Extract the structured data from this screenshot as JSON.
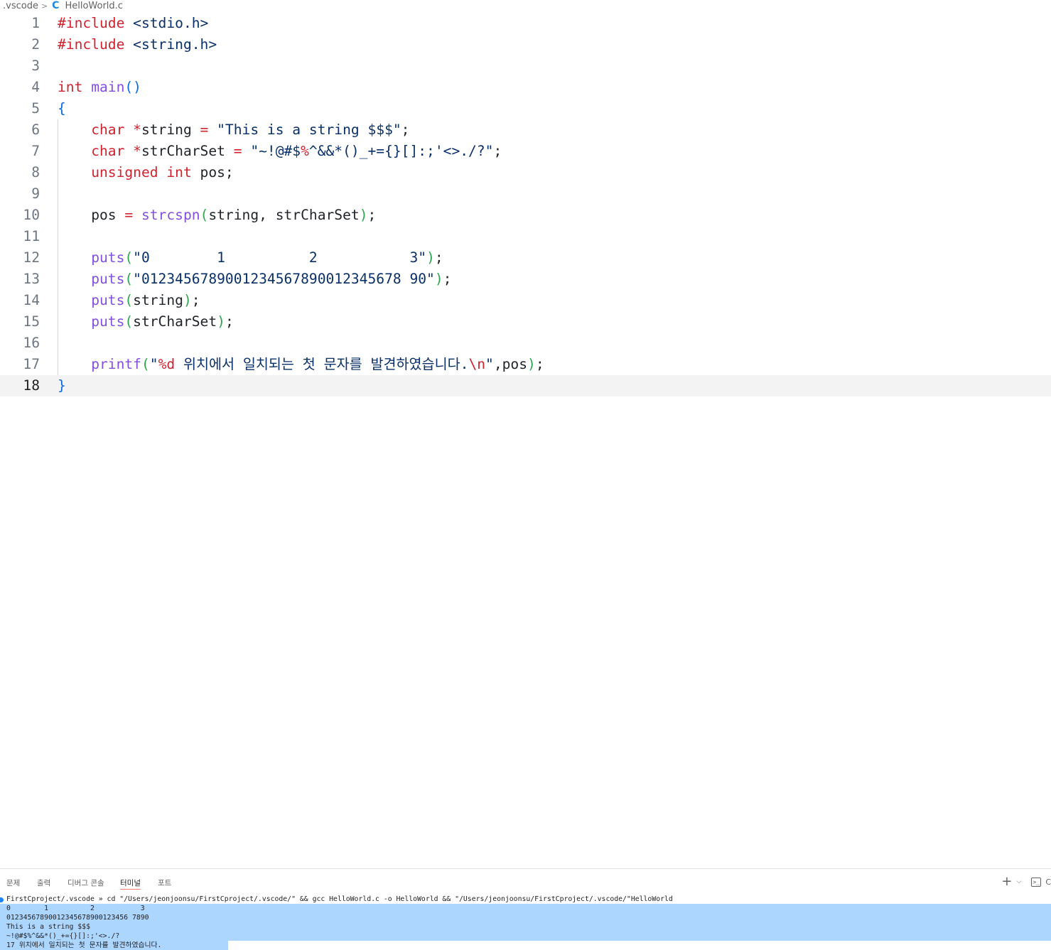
{
  "breadcrumb": {
    "folder": ".vscode",
    "separator": ">",
    "file_icon_glyph": "C",
    "file": "HelloWorld.c"
  },
  "editor": {
    "current_line": 18,
    "lines": [
      {
        "n": "1",
        "tokens": [
          [
            "kw",
            "#include"
          ],
          [
            "plain",
            " "
          ],
          [
            "inc",
            "<stdio.h>"
          ]
        ]
      },
      {
        "n": "2",
        "tokens": [
          [
            "kw",
            "#include"
          ],
          [
            "plain",
            " "
          ],
          [
            "inc",
            "<string.h>"
          ]
        ]
      },
      {
        "n": "3",
        "tokens": []
      },
      {
        "n": "4",
        "tokens": [
          [
            "kw",
            "int"
          ],
          [
            "plain",
            " "
          ],
          [
            "fn",
            "main"
          ],
          [
            "b1",
            "()"
          ]
        ]
      },
      {
        "n": "5",
        "tokens": [
          [
            "b1",
            "{"
          ]
        ]
      },
      {
        "n": "6",
        "tokens": [
          [
            "plain",
            "    "
          ],
          [
            "kw",
            "char"
          ],
          [
            "plain",
            " "
          ],
          [
            "op",
            "*"
          ],
          [
            "var",
            "string"
          ],
          [
            "plain",
            " "
          ],
          [
            "op",
            "="
          ],
          [
            "plain",
            " "
          ],
          [
            "str",
            "\"This is a string $$$\""
          ],
          [
            "var",
            ";"
          ]
        ]
      },
      {
        "n": "7",
        "tokens": [
          [
            "plain",
            "    "
          ],
          [
            "kw",
            "char"
          ],
          [
            "plain",
            " "
          ],
          [
            "op",
            "*"
          ],
          [
            "var",
            "strCharSet"
          ],
          [
            "plain",
            " "
          ],
          [
            "op",
            "="
          ],
          [
            "plain",
            " "
          ],
          [
            "str",
            "\"~!@#$"
          ],
          [
            "esc",
            "%"
          ],
          [
            "str",
            "^&&*()_+={}[]:;'<>./?\""
          ],
          [
            "var",
            ";"
          ]
        ]
      },
      {
        "n": "8",
        "tokens": [
          [
            "plain",
            "    "
          ],
          [
            "kw",
            "unsigned"
          ],
          [
            "plain",
            " "
          ],
          [
            "kw",
            "int"
          ],
          [
            "plain",
            " "
          ],
          [
            "var",
            "pos;"
          ]
        ]
      },
      {
        "n": "9",
        "tokens": []
      },
      {
        "n": "10",
        "tokens": [
          [
            "plain",
            "    "
          ],
          [
            "var",
            "pos"
          ],
          [
            "plain",
            " "
          ],
          [
            "op",
            "="
          ],
          [
            "plain",
            " "
          ],
          [
            "fn",
            "strcspn"
          ],
          [
            "b2",
            "("
          ],
          [
            "var",
            "string, strCharSet"
          ],
          [
            "b2",
            ")"
          ],
          [
            "var",
            ";"
          ]
        ]
      },
      {
        "n": "11",
        "tokens": []
      },
      {
        "n": "12",
        "tokens": [
          [
            "plain",
            "    "
          ],
          [
            "fn",
            "puts"
          ],
          [
            "b2",
            "("
          ],
          [
            "str",
            "\"0        1          2           3\""
          ],
          [
            "b2",
            ")"
          ],
          [
            "var",
            ";"
          ]
        ]
      },
      {
        "n": "13",
        "tokens": [
          [
            "plain",
            "    "
          ],
          [
            "fn",
            "puts"
          ],
          [
            "b2",
            "("
          ],
          [
            "str",
            "\"0123456789001234567890012345678 90\""
          ],
          [
            "b2",
            ")"
          ],
          [
            "var",
            ";"
          ]
        ]
      },
      {
        "n": "14",
        "tokens": [
          [
            "plain",
            "    "
          ],
          [
            "fn",
            "puts"
          ],
          [
            "b2",
            "("
          ],
          [
            "var",
            "string"
          ],
          [
            "b2",
            ")"
          ],
          [
            "var",
            ";"
          ]
        ]
      },
      {
        "n": "15",
        "tokens": [
          [
            "plain",
            "    "
          ],
          [
            "fn",
            "puts"
          ],
          [
            "b2",
            "("
          ],
          [
            "var",
            "strCharSet"
          ],
          [
            "b2",
            ")"
          ],
          [
            "var",
            ";"
          ]
        ]
      },
      {
        "n": "16",
        "tokens": []
      },
      {
        "n": "17",
        "tokens": [
          [
            "plain",
            "    "
          ],
          [
            "fn",
            "printf"
          ],
          [
            "b2",
            "("
          ],
          [
            "str",
            "\""
          ],
          [
            "esc",
            "%d"
          ],
          [
            "str",
            " 위치에서 일치되는 첫 문자를 발견하였습니다."
          ],
          [
            "esc",
            "\\n"
          ],
          [
            "str",
            "\""
          ],
          [
            "var",
            ",pos"
          ],
          [
            "b2",
            ")"
          ],
          [
            "var",
            ";"
          ]
        ]
      },
      {
        "n": "18",
        "tokens": [
          [
            "b1",
            "}"
          ]
        ]
      }
    ]
  },
  "panel": {
    "tabs": [
      {
        "label": "문제",
        "active": false
      },
      {
        "label": "출력",
        "active": false
      },
      {
        "label": "디버그 콘솔",
        "active": false
      },
      {
        "label": "터미널",
        "active": true
      },
      {
        "label": "포트",
        "active": false
      }
    ],
    "actions": {
      "plus": "+",
      "chevron": "⌵",
      "terminal_icon": ">_",
      "cut_label": "C"
    }
  },
  "terminal": {
    "lines": [
      "FirstCproject/.vscode » cd \"/Users/jeonjoonsu/FirstCproject/.vscode/\" && gcc HelloWorld.c -o HelloWorld && \"/Users/jeonjoonsu/FirstCproject/.vscode/\"HelloWorld",
      "0        1          2           3",
      "01234567890012345678900123456 7890",
      "This is a string $$$",
      "~!@#$%^&&*()_+={}[]:;'<>./?",
      "17 위치에서 일치되는 첫 문자를 발견하였습니다."
    ]
  },
  "colors": {
    "keyword": "#cf222e",
    "function": "#8250df",
    "string": "#0a3069",
    "bracket1": "#0969da",
    "bracket2": "#2da44e",
    "selection": "#add6ff",
    "active_tab_underline": "#f9826c"
  }
}
